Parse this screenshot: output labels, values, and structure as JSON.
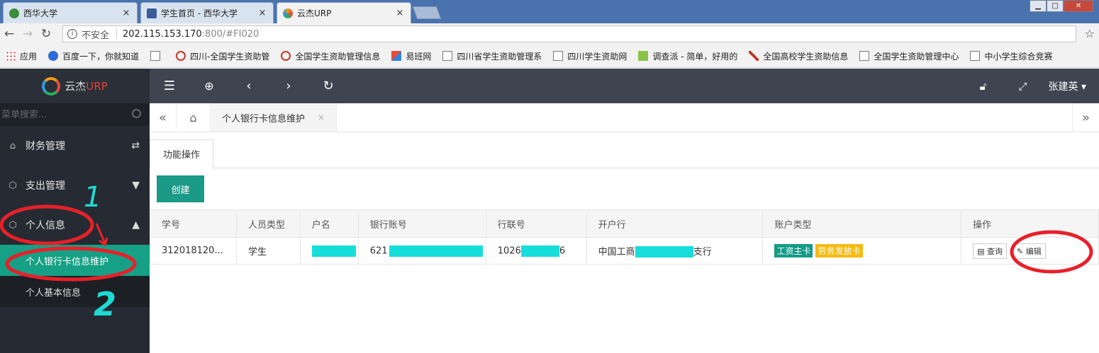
{
  "browser": {
    "tabs": [
      {
        "title": "西华大学",
        "active": false,
        "favicon_color": "#3a8d3a"
      },
      {
        "title": "学生首页 - 西华大学",
        "active": false,
        "favicon_color": "#3a5c9a"
      },
      {
        "title": "云杰URP",
        "active": true,
        "favicon_color": "#f39c12"
      }
    ],
    "tab_close": "×",
    "insecure_label": "不安全",
    "url_host": "202.115.153.170",
    "url_path": ":800/#FI020",
    "bookmarks": [
      {
        "label": "应用",
        "icon": "apps-grid-icon"
      },
      {
        "label": "百度一下，你就知道",
        "icon": "baidu-paw-icon"
      },
      {
        "label": "",
        "icon": "document-icon"
      },
      {
        "label": "四川-全国学生资助管",
        "icon": "funding-seal-icon"
      },
      {
        "label": "全国学生资助管理信息",
        "icon": "funding-seal-icon"
      },
      {
        "label": "易班网",
        "icon": "yiban-icon"
      },
      {
        "label": "四川省学生资助管理系",
        "icon": "document-icon"
      },
      {
        "label": "四川学生资助网",
        "icon": "document-icon"
      },
      {
        "label": "调查派 - 简单，好用的",
        "icon": "survey-icon"
      },
      {
        "label": "全国高校学生资助信息",
        "icon": "flag-icon"
      },
      {
        "label": "全国学生资助管理中心",
        "icon": "document-icon"
      },
      {
        "label": "中小学生综合竞赛",
        "icon": "document-icon"
      }
    ]
  },
  "app": {
    "logo": {
      "text": "云杰",
      "accent": "URP"
    },
    "search_placeholder": "菜单搜索...",
    "menu": [
      {
        "label": "财务管理",
        "icon": "home-icon",
        "tail": "⇄"
      },
      {
        "label": "支出管理",
        "icon": "cube-icon",
        "tail": "▼"
      },
      {
        "label": "个人信息",
        "icon": "cube-icon",
        "tail": "▲"
      }
    ],
    "submenu": [
      {
        "label": "个人银行卡信息维护",
        "active": true
      },
      {
        "label": "个人基本信息",
        "active": false
      }
    ],
    "user_name": "张建英 ▾",
    "open_tab": "个人银行卡信息维护",
    "function_tab": "功能操作",
    "create_label": "创建",
    "table": {
      "headers": [
        "学号",
        "人员类型",
        "户名",
        "银行账号",
        "行联号",
        "开户行",
        "账户类型",
        "操作"
      ],
      "row": {
        "student_id": "312018120...",
        "person_type": "学生",
        "account_prefix": "621",
        "bank_code_prefix": "1026",
        "bank_code_suffix": "6",
        "bank_prefix": "中国工商",
        "bank_suffix": "支行",
        "tags": [
          "工资主卡",
          "劳务发放卡"
        ],
        "actions": [
          "查询",
          "编辑"
        ]
      }
    }
  },
  "annotations": {
    "mark1": "1",
    "mark2": "2",
    "color_red": "#e8202a",
    "color_cyan": "#1fd9d3"
  }
}
